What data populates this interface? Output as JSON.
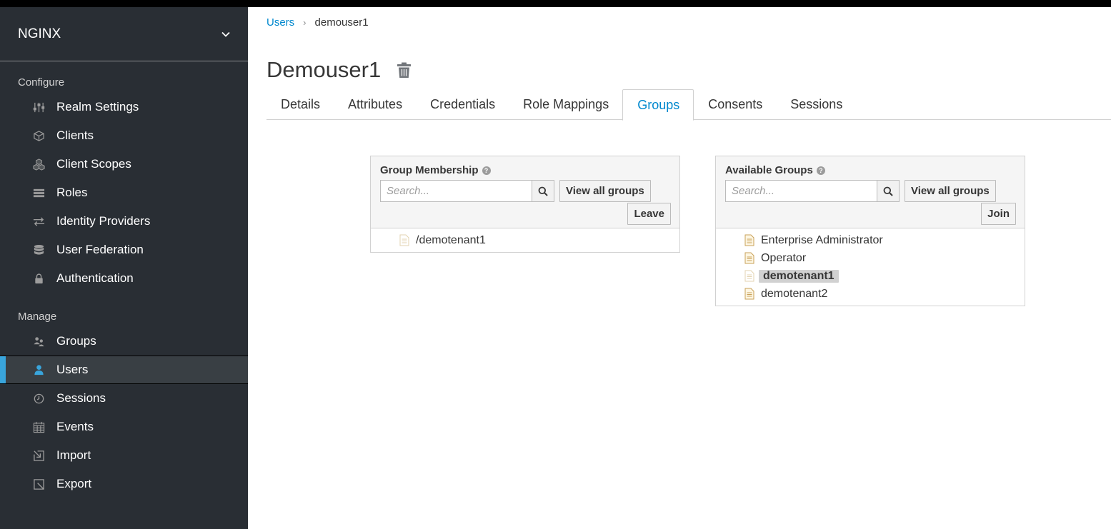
{
  "sidebar": {
    "realm": "NGINX",
    "configure_title": "Configure",
    "configure_items": [
      {
        "label": "Realm Settings",
        "icon": "sliders-icon"
      },
      {
        "label": "Clients",
        "icon": "cube-icon"
      },
      {
        "label": "Client Scopes",
        "icon": "cubes-icon"
      },
      {
        "label": "Roles",
        "icon": "list-icon"
      },
      {
        "label": "Identity Providers",
        "icon": "exchange-icon"
      },
      {
        "label": "User Federation",
        "icon": "database-icon"
      },
      {
        "label": "Authentication",
        "icon": "lock-icon"
      }
    ],
    "manage_title": "Manage",
    "manage_items": [
      {
        "label": "Groups",
        "icon": "users-icon"
      },
      {
        "label": "Users",
        "icon": "user-icon",
        "active": true
      },
      {
        "label": "Sessions",
        "icon": "clock-icon"
      },
      {
        "label": "Events",
        "icon": "calendar-icon"
      },
      {
        "label": "Import",
        "icon": "import-icon"
      },
      {
        "label": "Export",
        "icon": "export-icon"
      }
    ]
  },
  "breadcrumb": {
    "parent": "Users",
    "separator": "›",
    "current": "demouser1"
  },
  "page": {
    "title": "Demouser1"
  },
  "tabs": [
    {
      "label": "Details"
    },
    {
      "label": "Attributes"
    },
    {
      "label": "Credentials"
    },
    {
      "label": "Role Mappings"
    },
    {
      "label": "Groups",
      "active": true
    },
    {
      "label": "Consents"
    },
    {
      "label": "Sessions"
    }
  ],
  "membership": {
    "title": "Group Membership",
    "search_placeholder": "Search...",
    "view_all_label": "View all groups",
    "action_label": "Leave",
    "groups": [
      "/demotenant1"
    ]
  },
  "available": {
    "title": "Available Groups",
    "search_placeholder": "Search...",
    "view_all_label": "View all groups",
    "action_label": "Join",
    "groups": [
      "Enterprise Administrator",
      "Operator",
      "demotenant1",
      "demotenant2"
    ],
    "selected_index": 2
  },
  "colors": {
    "sidebar_bg": "#292e34",
    "accent": "#0088ce",
    "active_indicator": "#39a5dc",
    "file_icon": "#c9a15a"
  }
}
